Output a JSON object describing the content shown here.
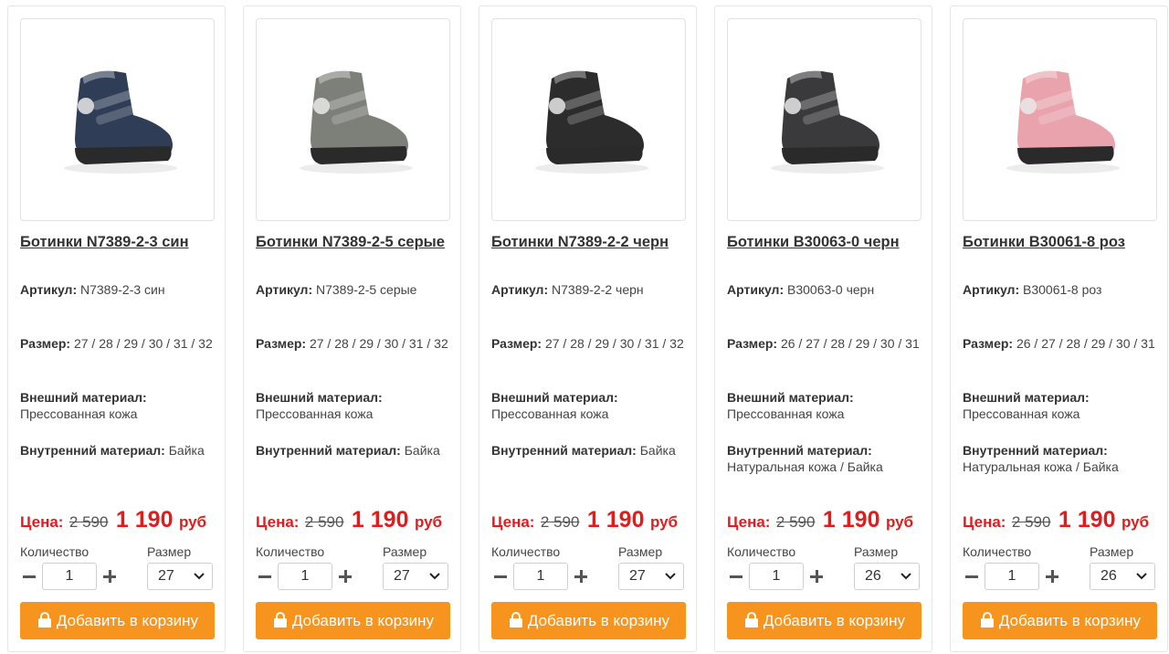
{
  "labels": {
    "article": "Артикул:",
    "size": "Размер:",
    "outer": "Внешний материал:",
    "inner": "Внутренний материал:",
    "price": "Цена:",
    "currency": "руб",
    "quantity": "Количество",
    "size_select": "Размер",
    "add_to_cart": "Добавить в корзину"
  },
  "colors": {
    "accent": "#f7941d",
    "price": "#e31b1b"
  },
  "products": [
    {
      "title": "Ботинки N7389-2-3 син",
      "article": "N7389-2-3 син",
      "sizes": "27 / 28 / 29 / 30 / 31 / 32",
      "outer_material": "Прессованная кожа",
      "inner_material": "Байка",
      "old_price": "2 590",
      "new_price": "1 190",
      "quantity": "1",
      "selected_size": "27",
      "image": "navy-sport-boot",
      "shoe_color": "#2f3d57"
    },
    {
      "title": "Ботинки N7389-2-5 серые",
      "article": "N7389-2-5 серые",
      "sizes": "27 / 28 / 29 / 30 / 31 / 32",
      "outer_material": "Прессованная кожа",
      "inner_material": "Байка",
      "old_price": "2 590",
      "new_price": "1 190",
      "quantity": "1",
      "selected_size": "27",
      "image": "grey-sport-boot",
      "shoe_color": "#7d7f79"
    },
    {
      "title": "Ботинки N7389-2-2 черн",
      "article": "N7389-2-2 черн",
      "sizes": "27 / 28 / 29 / 30 / 31 / 32",
      "outer_material": "Прессованная кожа",
      "inner_material": "Байка",
      "old_price": "2 590",
      "new_price": "1 190",
      "quantity": "1",
      "selected_size": "27",
      "image": "black-sport-boot",
      "shoe_color": "#2c2c2c"
    },
    {
      "title": "Ботинки B30063-0 черн",
      "article": "B30063-0 черн",
      "sizes": "26 / 27 / 28 / 29 / 30 / 31",
      "outer_material": "Прессованная кожа",
      "inner_material": "Натуральная кожа / Байка",
      "old_price": "2 590",
      "new_price": "1 190",
      "quantity": "1",
      "selected_size": "26",
      "image": "black-lace-up-boot",
      "shoe_color": "#3a3a3c"
    },
    {
      "title": "Ботинки B30061-8 роз",
      "article": "B30061-8 роз",
      "sizes": "26 / 27 / 28 / 29 / 30 / 31",
      "outer_material": "Прессованная кожа",
      "inner_material": "Натуральная кожа / Байка",
      "old_price": "2 590",
      "new_price": "1 190",
      "quantity": "1",
      "selected_size": "26",
      "image": "pink-fashion-boot",
      "shoe_color": "#e8a3ad"
    }
  ]
}
